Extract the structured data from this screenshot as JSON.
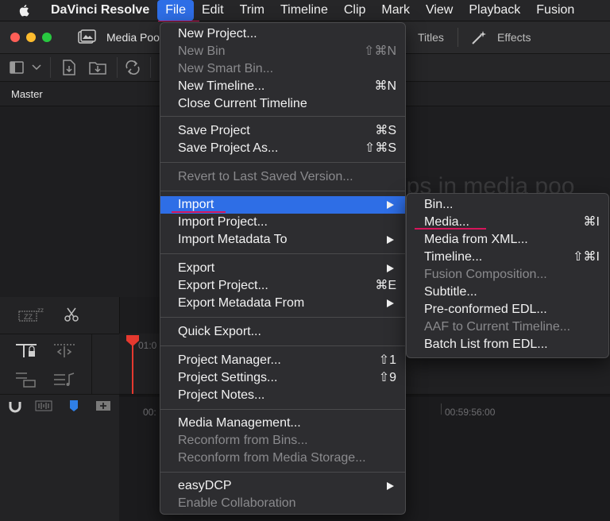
{
  "menubar": {
    "app_name": "DaVinci Resolve",
    "items": [
      "File",
      "Edit",
      "Trim",
      "Timeline",
      "Clip",
      "Mark",
      "View",
      "Playback",
      "Fusion"
    ]
  },
  "window": {
    "media_pool_tab": "Media Poo",
    "titles_tab": "Titles",
    "effects_tab": "Effects",
    "bin_label": "Master",
    "empty_hint": "ips in media poo",
    "timecode_start": "01:0",
    "timecode_mid_left": "00:",
    "timecode_mid": "00:59:56:00"
  },
  "file_menu": {
    "items": [
      {
        "label": "New Project...",
        "shortcut": "",
        "disabled": false,
        "submenu": false
      },
      {
        "label": "New Bin",
        "shortcut": "⇧⌘N",
        "disabled": true,
        "submenu": false
      },
      {
        "label": "New Smart Bin...",
        "shortcut": "",
        "disabled": true,
        "submenu": false
      },
      {
        "label": "New Timeline...",
        "shortcut": "⌘N",
        "disabled": false,
        "submenu": false
      },
      {
        "label": "Close Current Timeline",
        "shortcut": "",
        "disabled": false,
        "submenu": false
      },
      {
        "label": "Save Project",
        "shortcut": "⌘S",
        "disabled": false,
        "submenu": false
      },
      {
        "label": "Save Project As...",
        "shortcut": "⇧⌘S",
        "disabled": false,
        "submenu": false
      },
      {
        "label": "Revert to Last Saved Version...",
        "shortcut": "",
        "disabled": true,
        "submenu": false
      },
      {
        "label": "Import",
        "shortcut": "",
        "disabled": false,
        "submenu": true,
        "highlighted": true
      },
      {
        "label": "Import Project...",
        "shortcut": "",
        "disabled": false,
        "submenu": false
      },
      {
        "label": "Import Metadata To",
        "shortcut": "",
        "disabled": false,
        "submenu": true
      },
      {
        "label": "Export",
        "shortcut": "",
        "disabled": false,
        "submenu": true
      },
      {
        "label": "Export Project...",
        "shortcut": "⌘E",
        "disabled": false,
        "submenu": false
      },
      {
        "label": "Export Metadata From",
        "shortcut": "",
        "disabled": false,
        "submenu": true
      },
      {
        "label": "Quick Export...",
        "shortcut": "",
        "disabled": false,
        "submenu": false
      },
      {
        "label": "Project Manager...",
        "shortcut": "⇧1",
        "disabled": false,
        "submenu": false
      },
      {
        "label": "Project Settings...",
        "shortcut": "⇧9",
        "disabled": false,
        "submenu": false
      },
      {
        "label": "Project Notes...",
        "shortcut": "",
        "disabled": false,
        "submenu": false
      },
      {
        "label": "Media Management...",
        "shortcut": "",
        "disabled": false,
        "submenu": false
      },
      {
        "label": "Reconform from Bins...",
        "shortcut": "",
        "disabled": true,
        "submenu": false
      },
      {
        "label": "Reconform from Media Storage...",
        "shortcut": "",
        "disabled": true,
        "submenu": false
      },
      {
        "label": "easyDCP",
        "shortcut": "",
        "disabled": false,
        "submenu": true
      },
      {
        "label": "Enable Collaboration",
        "shortcut": "",
        "disabled": true,
        "submenu": false
      }
    ]
  },
  "import_submenu": {
    "items": [
      {
        "label": "Bin...",
        "shortcut": "",
        "disabled": false
      },
      {
        "label": "Media...",
        "shortcut": "⌘I",
        "disabled": false
      },
      {
        "label": "Media from XML...",
        "shortcut": "",
        "disabled": false
      },
      {
        "label": "Timeline...",
        "shortcut": "⇧⌘I",
        "disabled": false
      },
      {
        "label": "Fusion Composition...",
        "shortcut": "",
        "disabled": true
      },
      {
        "label": "Subtitle...",
        "shortcut": "",
        "disabled": false
      },
      {
        "label": "Pre-conformed EDL...",
        "shortcut": "",
        "disabled": false
      },
      {
        "label": "AAF to Current Timeline...",
        "shortcut": "",
        "disabled": true
      },
      {
        "label": "Batch List from EDL...",
        "shortcut": "",
        "disabled": false
      }
    ]
  },
  "colors": {
    "highlight": "#2e6ee6",
    "annotation_underline": "#d6155b",
    "playhead": "#e5392f"
  }
}
